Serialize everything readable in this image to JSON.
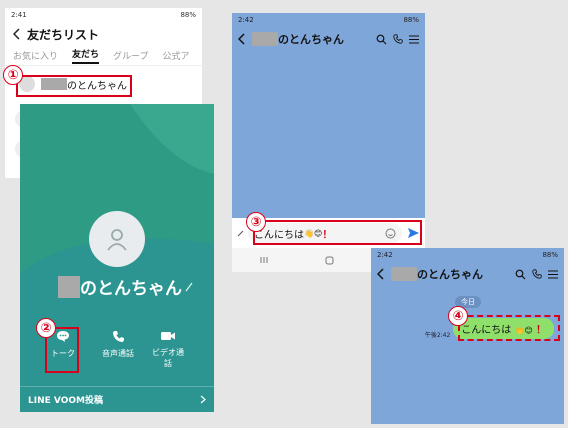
{
  "friends": {
    "status_time": "2:41",
    "status_battery": "88%",
    "title": "友だちリスト",
    "tabs": [
      "お気に入り",
      "友だち",
      "グループ",
      "公式ア"
    ],
    "active_tab": 1,
    "friend_name": "のとんちゃん"
  },
  "profile": {
    "name": "のとんちゃん",
    "actions": {
      "talk": "トーク",
      "voice": "音声通話",
      "video": "ビデオ通話"
    },
    "voom": "LINE VOOM投稿"
  },
  "chat1": {
    "status_time": "2:42",
    "status_battery": "88%",
    "name": "のとんちゃん",
    "input_text": "こんにちは",
    "input_emoji": "👋😊",
    "input_excl": "！"
  },
  "chat2": {
    "status_time": "2:42",
    "status_battery": "88%",
    "name": "のとんちゃん",
    "date": "今日",
    "time": "午後2:42",
    "message_text": "こんにちは",
    "message_emoji": "👋😊",
    "message_excl": "！"
  },
  "badges": [
    "①",
    "②",
    "③",
    "④"
  ],
  "colors": {
    "accent_red": "#d9001b",
    "line_green": "#06c755",
    "chat_bg": "#7fa6d8",
    "profile_bg": "#2e9b85",
    "bubble_green": "#8fe06a"
  }
}
